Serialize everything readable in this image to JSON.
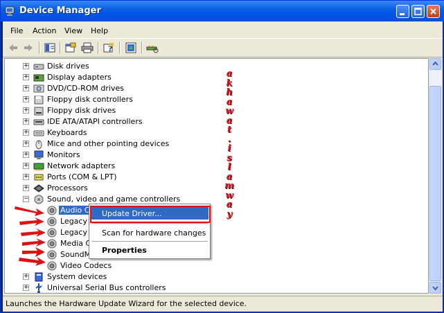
{
  "window": {
    "title": "Device Manager"
  },
  "menu": [
    "File",
    "Action",
    "View",
    "Help"
  ],
  "toolbar": {
    "icons": [
      "back-icon",
      "forward-icon",
      "properties-view-icon",
      "properties-icon",
      "print-icon",
      "help-icon",
      "update-driver-icon",
      "scan-hardware-icon"
    ]
  },
  "tree": [
    {
      "label": "Disk drives",
      "icon": "disk-drive-icon",
      "expander": "+"
    },
    {
      "label": "Display adapters",
      "icon": "display-adapter-icon",
      "expander": "+"
    },
    {
      "label": "DVD/CD-ROM drives",
      "icon": "cdrom-icon",
      "expander": "+"
    },
    {
      "label": "Floppy disk controllers",
      "icon": "floppy-controller-icon",
      "expander": "+"
    },
    {
      "label": "Floppy disk drives",
      "icon": "floppy-drive-icon",
      "expander": "+"
    },
    {
      "label": "IDE ATA/ATAPI controllers",
      "icon": "ide-controller-icon",
      "expander": "+"
    },
    {
      "label": "Keyboards",
      "icon": "keyboard-icon",
      "expander": "+"
    },
    {
      "label": "Mice and other pointing devices",
      "icon": "mouse-icon",
      "expander": "+"
    },
    {
      "label": "Monitors",
      "icon": "monitor-icon",
      "expander": "+"
    },
    {
      "label": "Network adapters",
      "icon": "network-adapter-icon",
      "expander": "+"
    },
    {
      "label": "Ports (COM & LPT)",
      "icon": "port-icon",
      "expander": "+"
    },
    {
      "label": "Processors",
      "icon": "processor-icon",
      "expander": "+"
    },
    {
      "label": "Sound, video and game controllers",
      "icon": "sound-controller-icon",
      "expander": "−"
    },
    {
      "label": "Audio Co",
      "icon": "speaker-icon",
      "child": true,
      "selected": true
    },
    {
      "label": "Legacy A",
      "icon": "speaker-icon",
      "child": true
    },
    {
      "label": "Legacy V",
      "icon": "speaker-icon",
      "child": true
    },
    {
      "label": "Media Co",
      "icon": "speaker-icon",
      "child": true
    },
    {
      "label": "SoundMA",
      "icon": "speaker-icon",
      "child": true
    },
    {
      "label": "Video Codecs",
      "icon": "speaker-icon",
      "child": true
    },
    {
      "label": "System devices",
      "icon": "system-device-icon",
      "expander": "+"
    },
    {
      "label": "Universal Serial Bus controllers",
      "icon": "usb-icon",
      "expander": "+"
    }
  ],
  "context_menu": {
    "update_driver": "Update Driver...",
    "scan": "Scan for hardware changes",
    "properties": "Properties"
  },
  "status": "Launches the Hardware Update Wizard for the selected device.",
  "watermark_letters": [
    "a",
    "k",
    "h",
    "a",
    "w",
    "a",
    "t",
    ".",
    "i",
    "s",
    "l",
    "a",
    "m",
    "w",
    "a",
    "y"
  ],
  "colors": {
    "title_bar": "#0054e3",
    "selection": "#316ac5",
    "annotation": "#e01010"
  }
}
